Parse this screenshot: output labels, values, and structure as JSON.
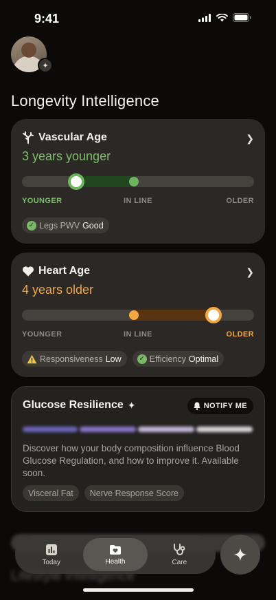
{
  "status": {
    "time": "9:41"
  },
  "section_title": "Longevity Intelligence",
  "vascular": {
    "title": "Vascular Age",
    "subtitle": "3 years younger",
    "scale": {
      "left": "YOUNGER",
      "middle": "IN LINE",
      "right": "OLDER"
    },
    "chips": [
      {
        "label": "Legs PWV",
        "value": "Good",
        "status": "good"
      }
    ]
  },
  "heart": {
    "title": "Heart Age",
    "subtitle": "4 years older",
    "scale": {
      "left": "YOUNGER",
      "middle": "IN LINE",
      "right": "OLDER"
    },
    "chips": [
      {
        "label": "Responsiveness",
        "value": "Low",
        "status": "warning"
      },
      {
        "label": "Efficiency",
        "value": "Optimal",
        "status": "good"
      }
    ]
  },
  "glucose": {
    "title": "Glucose Resilience",
    "notify_label": "NOTIFY ME",
    "description": "Discover how your body composition influence Blood Glucose Regulation, and how to improve it. Available soon.",
    "tags": [
      "Visceral Fat",
      "Nerve Response Score"
    ]
  },
  "ghost_text": "Lifestyle Intelligence",
  "tabs": [
    {
      "label": "Today",
      "icon": "chart-icon"
    },
    {
      "label": "Health",
      "icon": "heart-folder-icon",
      "active": true
    },
    {
      "label": "Care",
      "icon": "stethoscope-icon"
    }
  ],
  "colors": {
    "green": "#7cbf6a",
    "orange": "#f2a843",
    "card": "#2b2825"
  }
}
